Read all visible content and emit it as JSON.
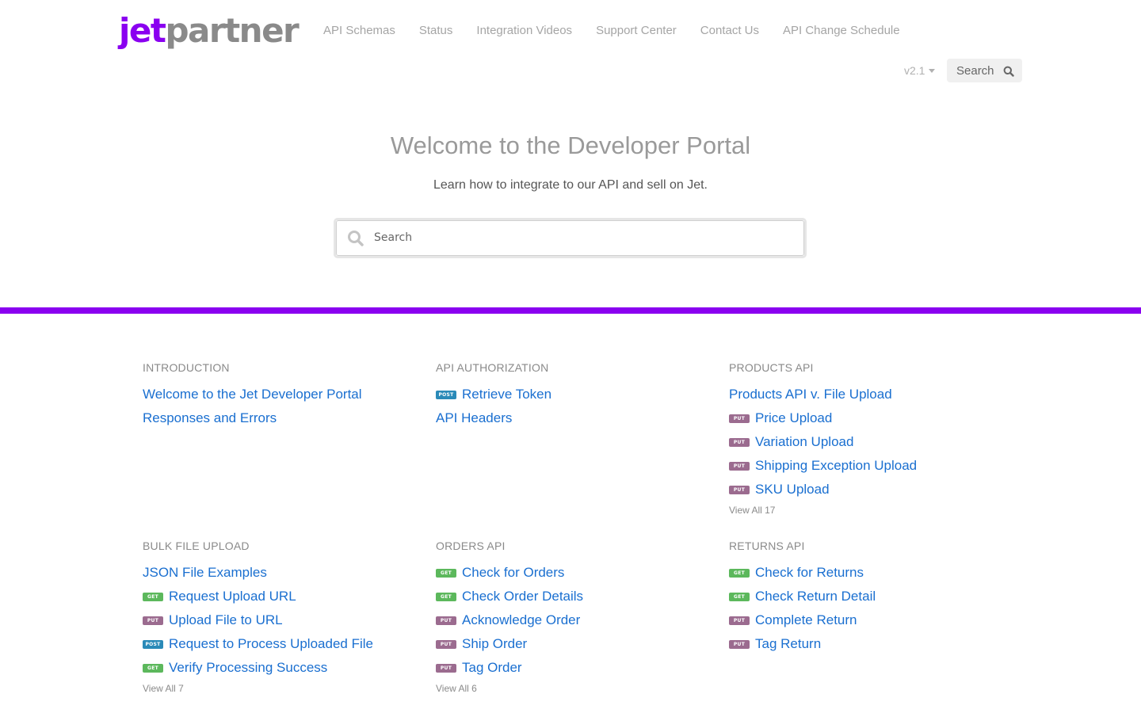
{
  "header": {
    "logo_primary": "jet",
    "logo_secondary": "partner",
    "nav": [
      "API Schemas",
      "Status",
      "Integration Videos",
      "Support Center",
      "Contact Us",
      "API Change Schedule"
    ],
    "version": "v2.1",
    "search_label": "Search"
  },
  "hero": {
    "title": "Welcome to the Developer Portal",
    "subtitle": "Learn how to integrate to our API and sell on Jet.",
    "search_placeholder": "Search"
  },
  "colors": {
    "brand": "#8a00f0",
    "link": "#1a6fd0",
    "get": "#5cb85c",
    "put": "#9b6b8f",
    "post": "#2a8ab8"
  },
  "sections": [
    {
      "title": "INTRODUCTION",
      "items": [
        {
          "method": "",
          "label": "Welcome to the Jet Developer Portal"
        },
        {
          "method": "",
          "label": "Responses and Errors"
        }
      ],
      "view_all": ""
    },
    {
      "title": "API AUTHORIZATION",
      "items": [
        {
          "method": "POST",
          "label": "Retrieve Token"
        },
        {
          "method": "",
          "label": "API Headers"
        }
      ],
      "view_all": ""
    },
    {
      "title": "PRODUCTS API",
      "items": [
        {
          "method": "",
          "label": "Products API v. File Upload"
        },
        {
          "method": "PUT",
          "label": "Price Upload"
        },
        {
          "method": "PUT",
          "label": "Variation Upload"
        },
        {
          "method": "PUT",
          "label": "Shipping Exception Upload"
        },
        {
          "method": "PUT",
          "label": "SKU Upload"
        }
      ],
      "view_all": "View All 17"
    },
    {
      "title": "BULK FILE UPLOAD",
      "items": [
        {
          "method": "",
          "label": "JSON File Examples"
        },
        {
          "method": "GET",
          "label": "Request Upload URL"
        },
        {
          "method": "PUT",
          "label": "Upload File to URL"
        },
        {
          "method": "POST",
          "label": "Request to Process Uploaded File"
        },
        {
          "method": "GET",
          "label": "Verify Processing Success"
        }
      ],
      "view_all": "View All 7"
    },
    {
      "title": "ORDERS API",
      "items": [
        {
          "method": "GET",
          "label": "Check for Orders"
        },
        {
          "method": "GET",
          "label": "Check Order Details"
        },
        {
          "method": "PUT",
          "label": "Acknowledge Order"
        },
        {
          "method": "PUT",
          "label": "Ship Order"
        },
        {
          "method": "PUT",
          "label": "Tag Order"
        }
      ],
      "view_all": "View All 6"
    },
    {
      "title": "RETURNS API",
      "items": [
        {
          "method": "GET",
          "label": "Check for Returns"
        },
        {
          "method": "GET",
          "label": "Check Return Detail"
        },
        {
          "method": "PUT",
          "label": "Complete Return"
        },
        {
          "method": "PUT",
          "label": "Tag Return"
        }
      ],
      "view_all": ""
    }
  ]
}
